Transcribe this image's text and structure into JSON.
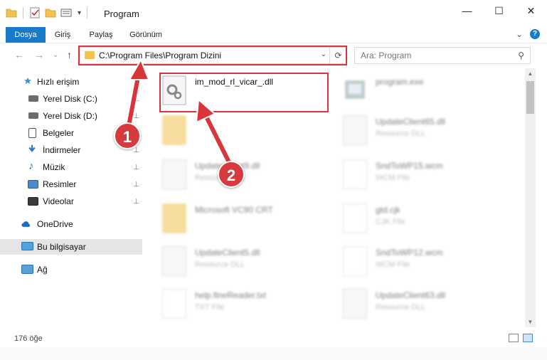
{
  "window": {
    "title": "Program",
    "minimize_glyph": "—",
    "maximize_glyph": "☐",
    "close_glyph": "✕"
  },
  "ribbon": {
    "tabs": [
      "Dosya",
      "Giriş",
      "Paylaş",
      "Görünüm"
    ],
    "active_tab": "Dosya",
    "help_glyph": "?",
    "expand_glyph": "⌄"
  },
  "nav": {
    "back_glyph": "←",
    "forward_glyph": "→",
    "recent_glyph": "⌄",
    "up_glyph": "↑",
    "address": "C:\\Program Files\\Program Dizini",
    "dropdown_glyph": "⌄",
    "refresh_glyph": "⟳",
    "search_placeholder": "Ara: Program",
    "search_glyph": "⚲"
  },
  "sidebar": {
    "items": [
      {
        "label": "Hızlı erişim",
        "icon": "star-icon",
        "pinned": false
      },
      {
        "label": "Yerel Disk (C:)",
        "icon": "drive-icon",
        "pinned": true
      },
      {
        "label": "Yerel Disk (D:)",
        "icon": "drive-icon",
        "pinned": true
      },
      {
        "label": "Belgeler",
        "icon": "documents-icon",
        "pinned": true
      },
      {
        "label": "İndirmeler",
        "icon": "download-icon",
        "pinned": true
      },
      {
        "label": "Müzik",
        "icon": "music-icon",
        "pinned": true
      },
      {
        "label": "Resimler",
        "icon": "pictures-icon",
        "pinned": true
      },
      {
        "label": "Videolar",
        "icon": "videos-icon",
        "pinned": true
      },
      {
        "label": "OneDrive",
        "icon": "cloud-icon",
        "pinned": false
      },
      {
        "label": "Bu bilgisayar",
        "icon": "computer-icon",
        "pinned": false,
        "selected": true
      },
      {
        "label": "Ağ",
        "icon": "network-icon",
        "pinned": false
      }
    ],
    "pin_glyph": "📌"
  },
  "files": [
    {
      "name": "im_mod_rl_vicar_.dll",
      "type": "",
      "icon": "dll-gear-icon",
      "blurred": false
    },
    {
      "name": "program.exe",
      "type": "",
      "icon": "exe-icon",
      "blurred": true
    },
    {
      "name": "",
      "type": "",
      "icon": "folder-icon",
      "blurred": true
    },
    {
      "name": "UpdateClient65.dll",
      "type": "Resource DLL",
      "icon": "dll-gear-icon",
      "blurred": true
    },
    {
      "name": "UpdateClient9.dll",
      "type": "Resource DLL",
      "icon": "dll-gear-icon",
      "blurred": true
    },
    {
      "name": "SndToWP15.wcm",
      "type": "WCM File",
      "icon": "document-icon",
      "blurred": true
    },
    {
      "name": "Microsoft VC90 CRT",
      "type": "",
      "icon": "folder-icon",
      "blurred": true
    },
    {
      "name": "gtd.cjk",
      "type": "CJK File",
      "icon": "document-icon",
      "blurred": true
    },
    {
      "name": "UpdateClient5.dll",
      "type": "Resource DLL",
      "icon": "dll-gear-icon",
      "blurred": true
    },
    {
      "name": "SndToWP12.wcm",
      "type": "WCM File",
      "icon": "document-icon",
      "blurred": true
    },
    {
      "name": "help.fineReader.txt",
      "type": "TXT File",
      "icon": "document-icon",
      "blurred": true
    },
    {
      "name": "UpdateClient63.dll",
      "type": "Resource DLL",
      "icon": "dll-gear-icon",
      "blurred": true
    }
  ],
  "status": {
    "count": "176 öğe"
  },
  "annotations": {
    "badge1": "1",
    "badge2": "2",
    "color": "#d9343a"
  }
}
